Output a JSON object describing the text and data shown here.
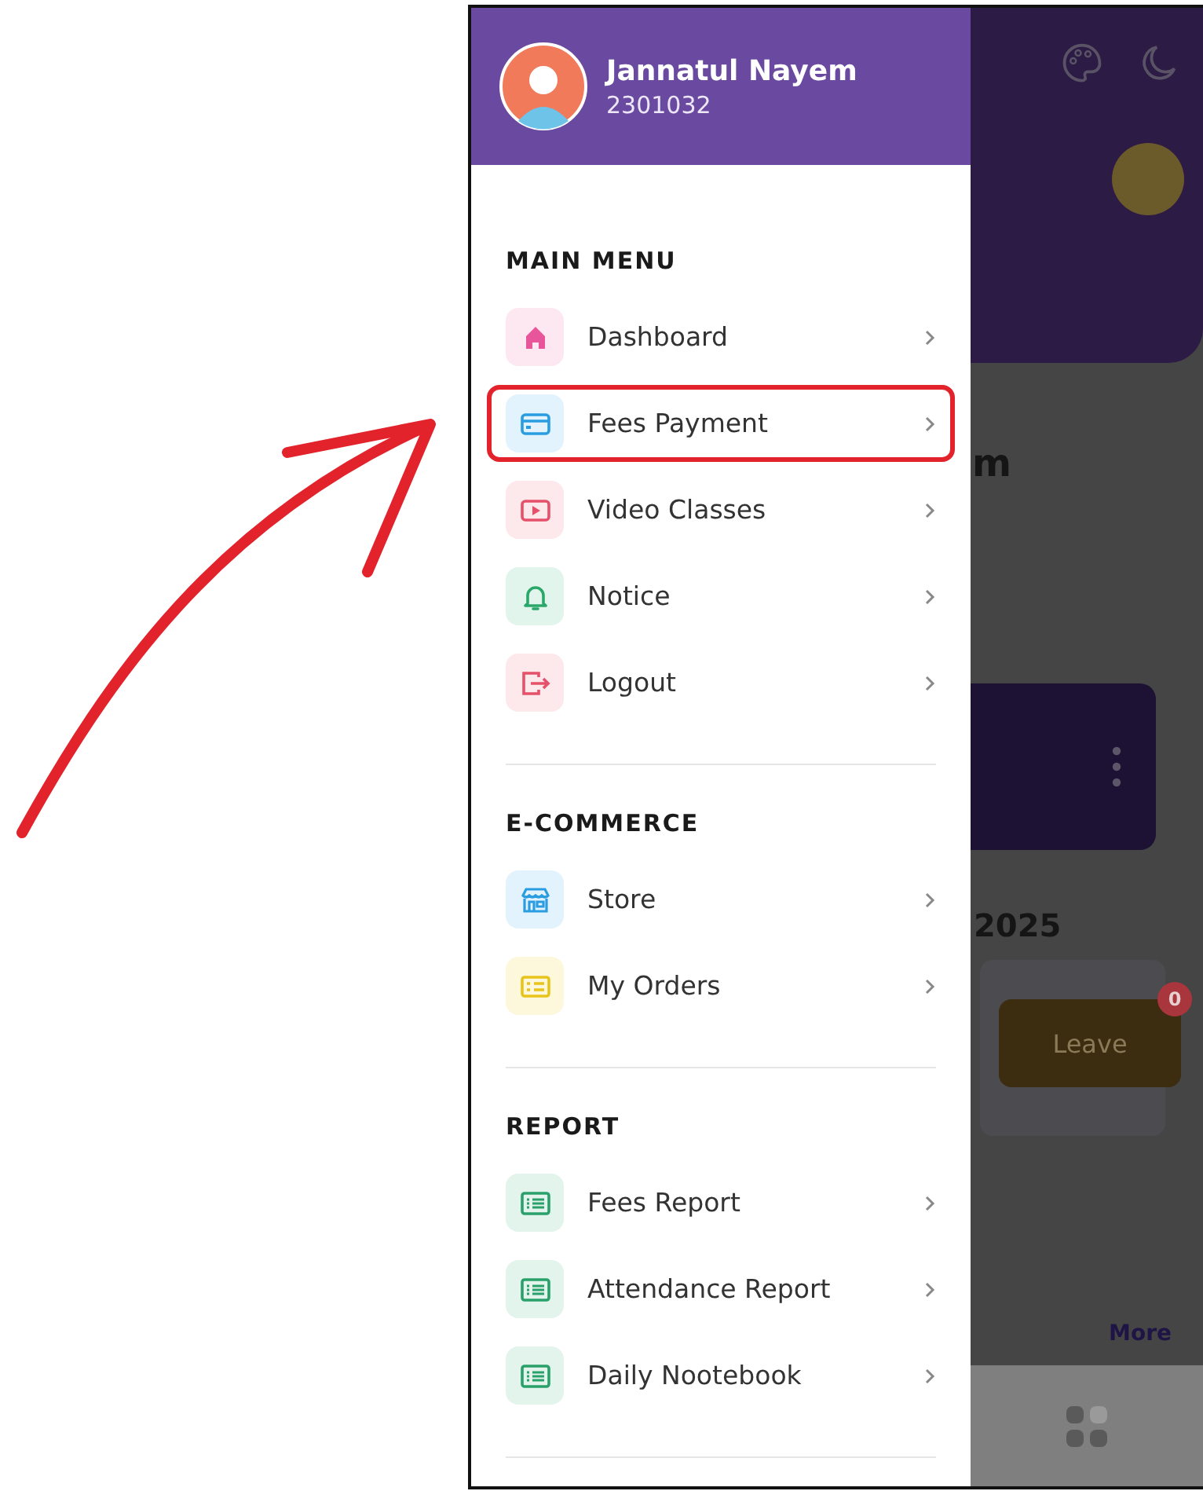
{
  "profile": {
    "name": "Jannatul Nayem",
    "id": "2301032"
  },
  "sections": [
    {
      "title": "MAIN MENU",
      "items": [
        {
          "label": "Dashboard",
          "kind": "home",
          "highlighted": false
        },
        {
          "label": "Fees Payment",
          "kind": "card",
          "highlighted": true
        },
        {
          "label": "Video Classes",
          "kind": "video",
          "highlighted": false
        },
        {
          "label": "Notice",
          "kind": "bell",
          "highlighted": false
        },
        {
          "label": "Logout",
          "kind": "logout",
          "highlighted": false
        }
      ]
    },
    {
      "title": "E-COMMERCE",
      "items": [
        {
          "label": "Store",
          "kind": "store",
          "highlighted": false
        },
        {
          "label": "My Orders",
          "kind": "orders",
          "highlighted": false
        }
      ]
    },
    {
      "title": "REPORT",
      "items": [
        {
          "label": "Fees Report",
          "kind": "report",
          "highlighted": false
        },
        {
          "label": "Attendance Report",
          "kind": "report",
          "highlighted": false
        },
        {
          "label": "Daily Nootebook",
          "kind": "report",
          "highlighted": false
        }
      ]
    }
  ],
  "background": {
    "heading_fragment": "m",
    "year_fragment": "2025",
    "leave_button": "Leave",
    "leave_badge": "0",
    "more_link": "More"
  }
}
